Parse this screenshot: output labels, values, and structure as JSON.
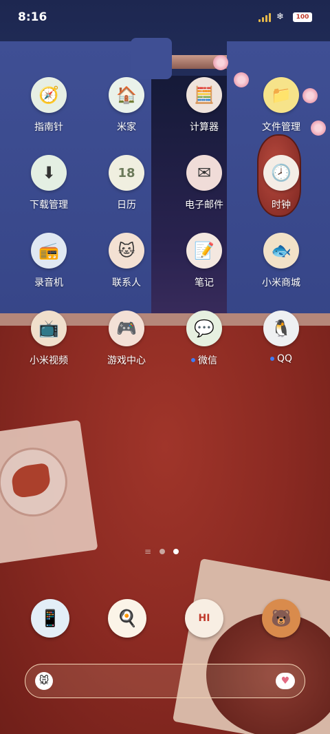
{
  "status_bar": {
    "time": "8:16",
    "battery": "100"
  },
  "apps": [
    {
      "label": "指南针",
      "icon": "compass-icon",
      "glyph": "🧭",
      "bg": "#e7efe4"
    },
    {
      "label": "米家",
      "icon": "mijia-icon",
      "glyph": "🏠",
      "bg": "#eaf2ea"
    },
    {
      "label": "计算器",
      "icon": "calculator-icon",
      "glyph": "🧮",
      "bg": "#efe3dc"
    },
    {
      "label": "文件管理",
      "icon": "folder-icon",
      "glyph": "📁",
      "bg": "#f6e38a"
    },
    {
      "label": "下载管理",
      "icon": "download-icon",
      "glyph": "⬇",
      "bg": "#e4efe3"
    },
    {
      "label": "日历",
      "icon": "calendar-icon",
      "glyph": "18",
      "bg": "#f0efe0"
    },
    {
      "label": "电子邮件",
      "icon": "mail-icon",
      "glyph": "✉",
      "bg": "#f0dcd8"
    },
    {
      "label": "时钟",
      "icon": "clock-icon",
      "glyph": "🕗",
      "bg": "#f4ede6"
    },
    {
      "label": "录音机",
      "icon": "recorder-icon",
      "glyph": "📻",
      "bg": "#e0e8f2"
    },
    {
      "label": "联系人",
      "icon": "contacts-icon",
      "glyph": "🐱",
      "bg": "#f3e1d3"
    },
    {
      "label": "笔记",
      "icon": "notes-icon",
      "glyph": "📝",
      "bg": "#f4e8e0"
    },
    {
      "label": "小米商城",
      "icon": "mi-store-icon",
      "glyph": "🐟",
      "bg": "#f2e2c8"
    },
    {
      "label": "小米视频",
      "icon": "mi-video-icon",
      "glyph": "📺",
      "bg": "#f0dfcc"
    },
    {
      "label": "游戏中心",
      "icon": "game-center-icon",
      "glyph": "🎮",
      "bg": "#f3e0d6"
    },
    {
      "label": "微信",
      "icon": "wechat-icon",
      "glyph": "💬",
      "bg": "#e6f0e0",
      "badge": true
    },
    {
      "label": "QQ",
      "icon": "qq-icon",
      "glyph": "🐧",
      "bg": "#eef0f2",
      "badge": true
    }
  ],
  "dock": [
    {
      "name": "phone-icon",
      "glyph": "📱",
      "bg": "#e3eef7"
    },
    {
      "name": "browser-icon",
      "glyph": "🍳",
      "bg": "#fbf4e8"
    },
    {
      "name": "messages-icon",
      "glyph": "HI",
      "bg": "#f8eee3"
    },
    {
      "name": "camera-icon",
      "glyph": "🐻",
      "bg": "#d98b4c"
    }
  ],
  "page_indicator": {
    "menu": "≡",
    "pages": 2,
    "active": 1
  }
}
